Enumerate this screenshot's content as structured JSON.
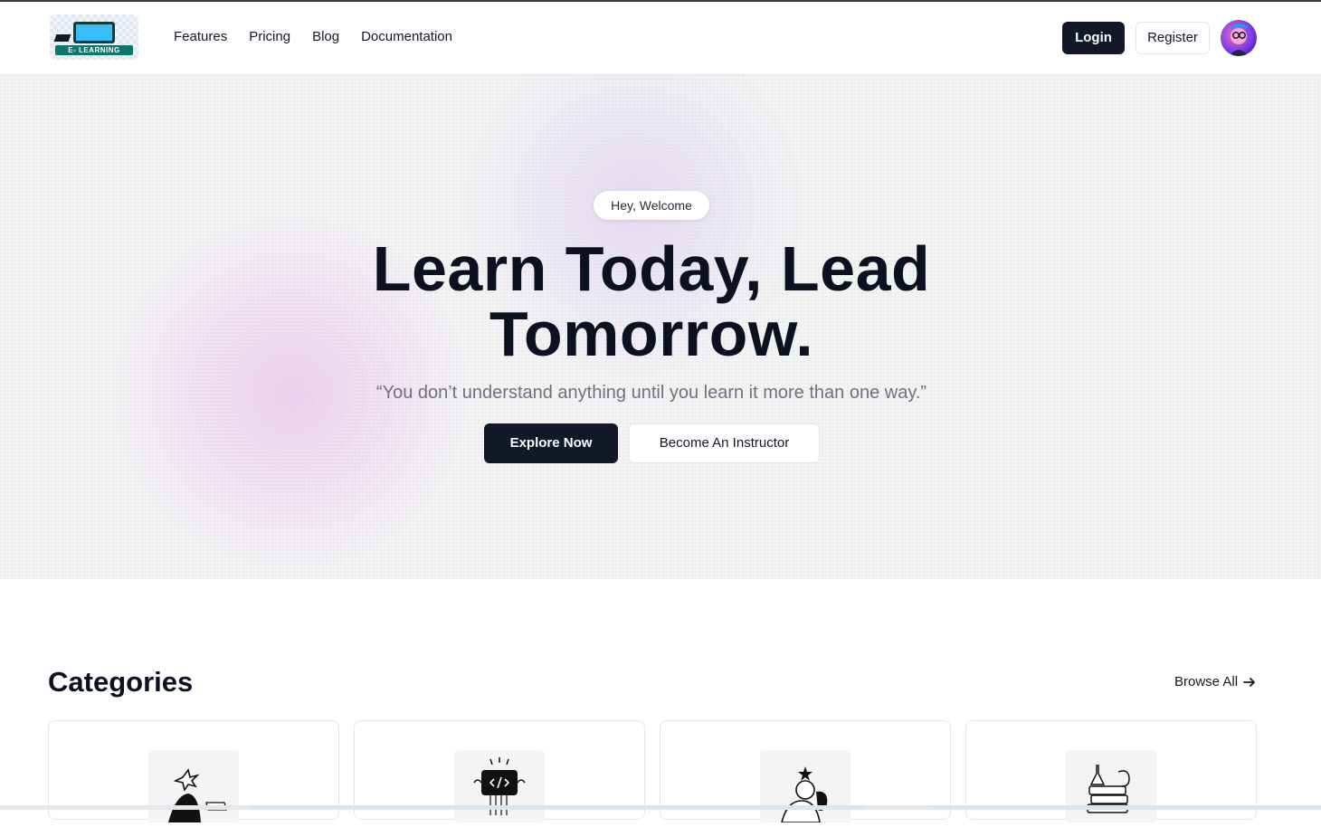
{
  "header": {
    "logo_text": "E- LEARNING",
    "nav": [
      "Features",
      "Pricing",
      "Blog",
      "Documentation"
    ],
    "login_label": "Login",
    "register_label": "Register"
  },
  "hero": {
    "badge": "Hey, Welcome",
    "headline_line1": "Learn Today, Lead",
    "headline_line2": "Tomorrow.",
    "quote": "“You don’t understand anything until you learn it more than one way.”",
    "primary_cta": "Explore Now",
    "secondary_cta": "Become An Instructor"
  },
  "categories": {
    "title": "Categories",
    "browse_label": "Browse All",
    "cards": [
      {
        "icon": "person-star-illustration-icon"
      },
      {
        "icon": "code-window-illustration-icon"
      },
      {
        "icon": "person-idea-illustration-icon"
      },
      {
        "icon": "science-stack-illustration-icon"
      }
    ]
  },
  "colors": {
    "primary": "#111827",
    "hero_background": "#f3f3f4",
    "muted_text": "#6b7280"
  }
}
